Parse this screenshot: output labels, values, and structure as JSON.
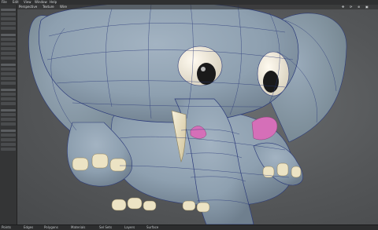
{
  "window": {
    "top_menu": [
      "File",
      "Edit",
      "View",
      "Window",
      "Help"
    ]
  },
  "viewport": {
    "header_items": [
      "Perspective",
      "Texture",
      "Wire"
    ],
    "nav_icons": [
      "move-icon",
      "rotate-icon",
      "zoom-icon",
      "maximize-icon"
    ]
  },
  "sidebar": {
    "tool_groups": [
      "Create",
      "Modify",
      "Detail",
      "Map",
      "Setup",
      "Utilities"
    ]
  },
  "status": {
    "tabs": [
      "Points",
      "Edges",
      "Polygons",
      "Materials",
      "Sel Sets",
      "Layers",
      "Surface"
    ]
  },
  "colors": {
    "background": "#3a3b3c",
    "model_skin": "#8fa1b1",
    "model_shadow": "#6e7f8e",
    "tusk": "#ece3c4",
    "tongue": "#d56fb8",
    "wire": "#2b3a7a",
    "eye_white": "#f2ede0",
    "pupil": "#1a1a1a"
  }
}
